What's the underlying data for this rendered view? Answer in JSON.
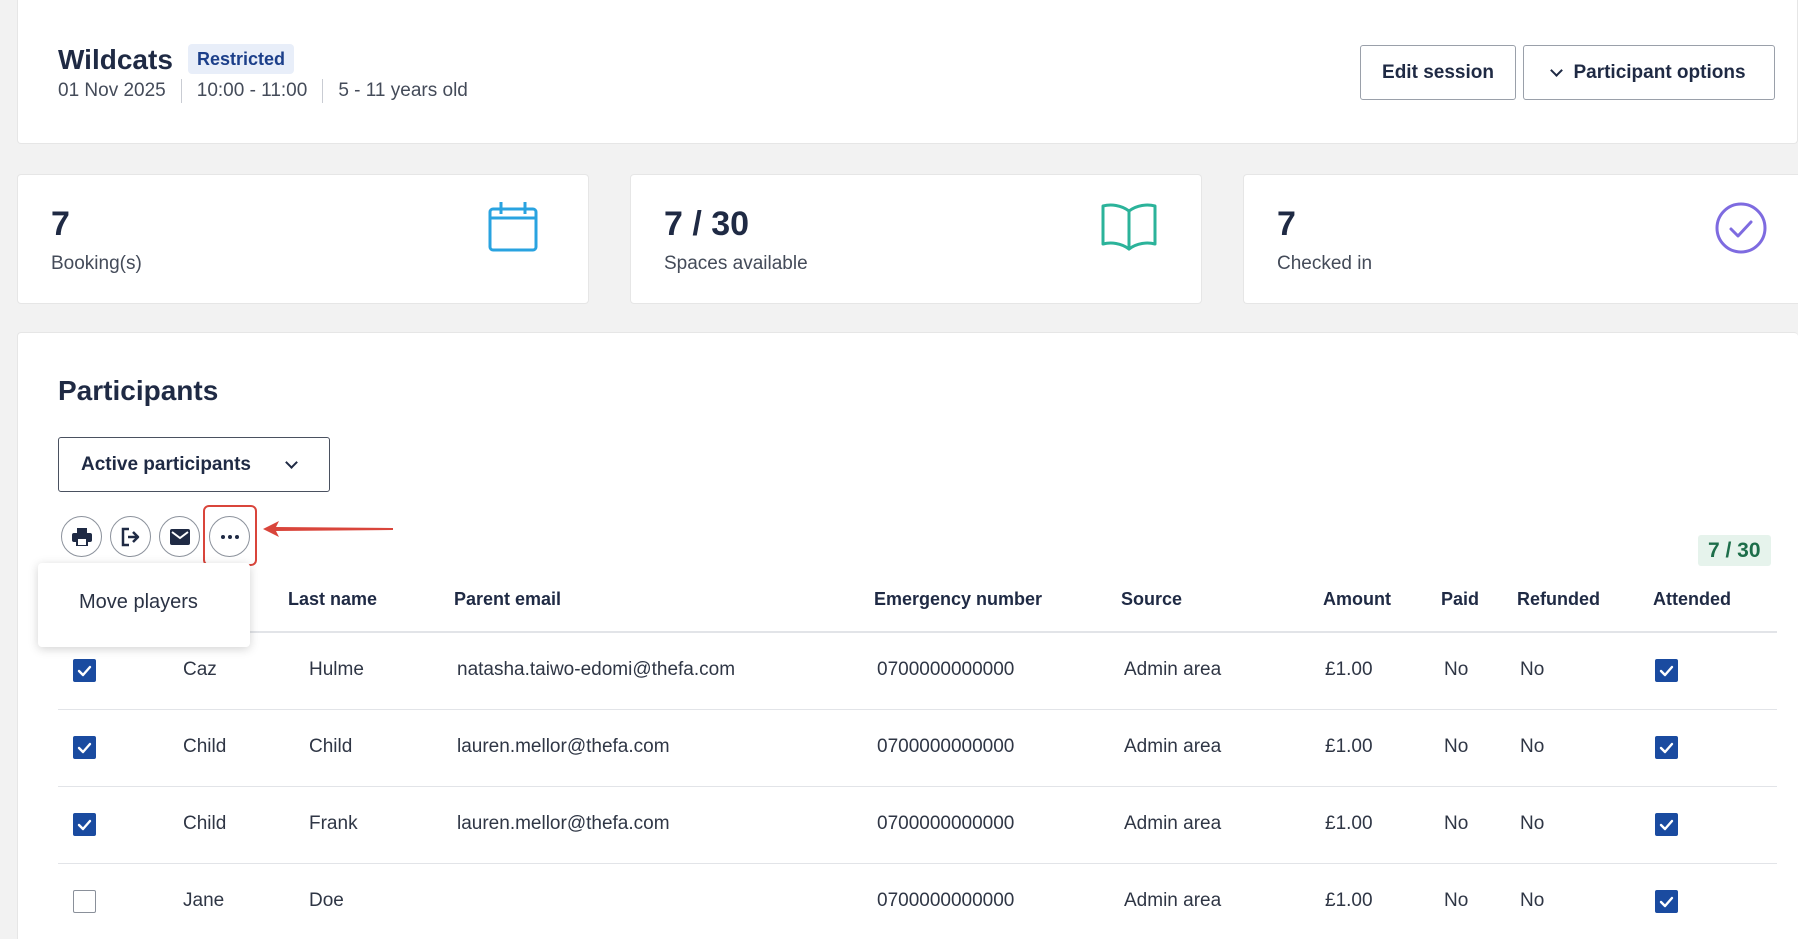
{
  "session": {
    "title": "Wildcats",
    "badge": "Restricted",
    "date": "01 Nov 2025",
    "time": "10:00 - 11:00",
    "age": "5 - 11 years old",
    "edit_label": "Edit session",
    "options_label": "Participant options"
  },
  "stats": [
    {
      "value": "7",
      "label": "Booking(s)",
      "icon": "calendar-icon",
      "color": "#29a3e0"
    },
    {
      "value": "7 / 30",
      "label": "Spaces available",
      "icon": "book-icon",
      "color": "#2bb39a"
    },
    {
      "value": "7",
      "label": "Checked in",
      "icon": "check-circle-icon",
      "color": "#7e6be0"
    }
  ],
  "participants": {
    "title": "Participants",
    "filter": "Active participants",
    "count": "7 / 30",
    "menu_item": "Move players",
    "toolbar_icons": [
      "print-icon",
      "export-icon",
      "email-icon",
      "more-icon"
    ],
    "columns": [
      "Last name",
      "Parent email",
      "Emergency number",
      "Source",
      "Amount",
      "Paid",
      "Refunded",
      "Attended"
    ],
    "rows": [
      {
        "selected": true,
        "first": "Caz",
        "last": "Hulme",
        "email": "natasha.taiwo-edomi@thefa.com",
        "phone": "0700000000000",
        "source": "Admin area",
        "amount": "£1.00",
        "paid": "No",
        "refunded": "No",
        "attended": true
      },
      {
        "selected": true,
        "first": "Child",
        "last": "Child",
        "email": "lauren.mellor@thefa.com",
        "phone": "0700000000000",
        "source": "Admin area",
        "amount": "£1.00",
        "paid": "No",
        "refunded": "No",
        "attended": true
      },
      {
        "selected": true,
        "first": "Child",
        "last": "Frank",
        "email": "lauren.mellor@thefa.com",
        "phone": "0700000000000",
        "source": "Admin area",
        "amount": "£1.00",
        "paid": "No",
        "refunded": "No",
        "attended": true
      },
      {
        "selected": false,
        "first": "Jane",
        "last": "Doe",
        "email": "",
        "phone": "0700000000000",
        "source": "Admin area",
        "amount": "£1.00",
        "paid": "No",
        "refunded": "No",
        "attended": true
      }
    ]
  },
  "colors": {
    "accent": "#1a4ba0",
    "highlight": "#d9453b",
    "count_green": "#1d6e4a"
  }
}
